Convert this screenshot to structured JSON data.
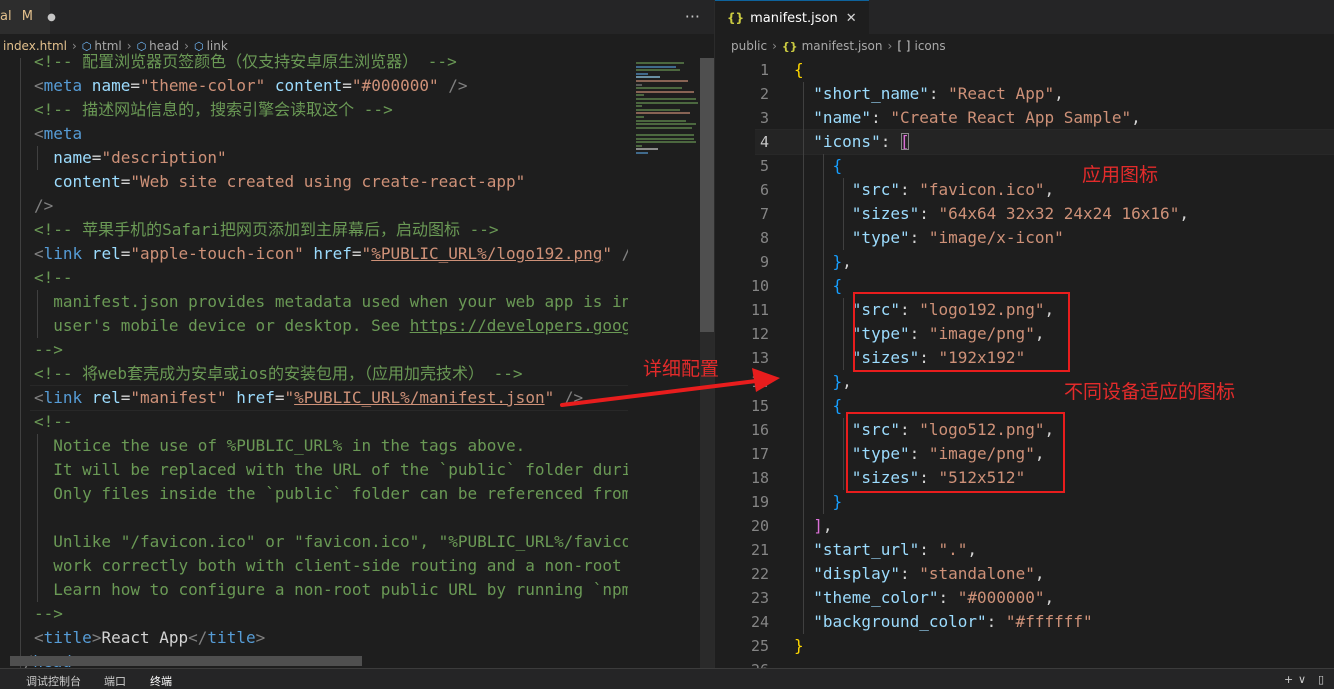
{
  "left_editor": {
    "tab": {
      "label_prefix": "al",
      "modified_marker": "M",
      "dot": "●"
    },
    "more_actions": "···",
    "breadcrumb": [
      "index.html",
      "html",
      "head",
      "link"
    ]
  },
  "right_editor": {
    "tab": {
      "icon_text": "{}",
      "label": "manifest.json",
      "close": "✕"
    },
    "breadcrumb": [
      "public",
      "manifest.json",
      "icons"
    ]
  },
  "status_bar": {
    "tabs": [
      "调试控制台",
      "端口",
      "终端"
    ],
    "active_tab": "终端",
    "right_icons": [
      "+",
      "∨",
      "▯"
    ]
  },
  "annotations": {
    "detail_config": "详细配置",
    "app_icon": "应用图标",
    "device_icons": "不同设备适应的图标"
  },
  "colors": {
    "background": "#1e1e1e",
    "comment": "#6a9955",
    "tag": "#569cd6",
    "attribute": "#9cdcfe",
    "string": "#ce9178",
    "annotation_red": "#e32b2b"
  }
}
